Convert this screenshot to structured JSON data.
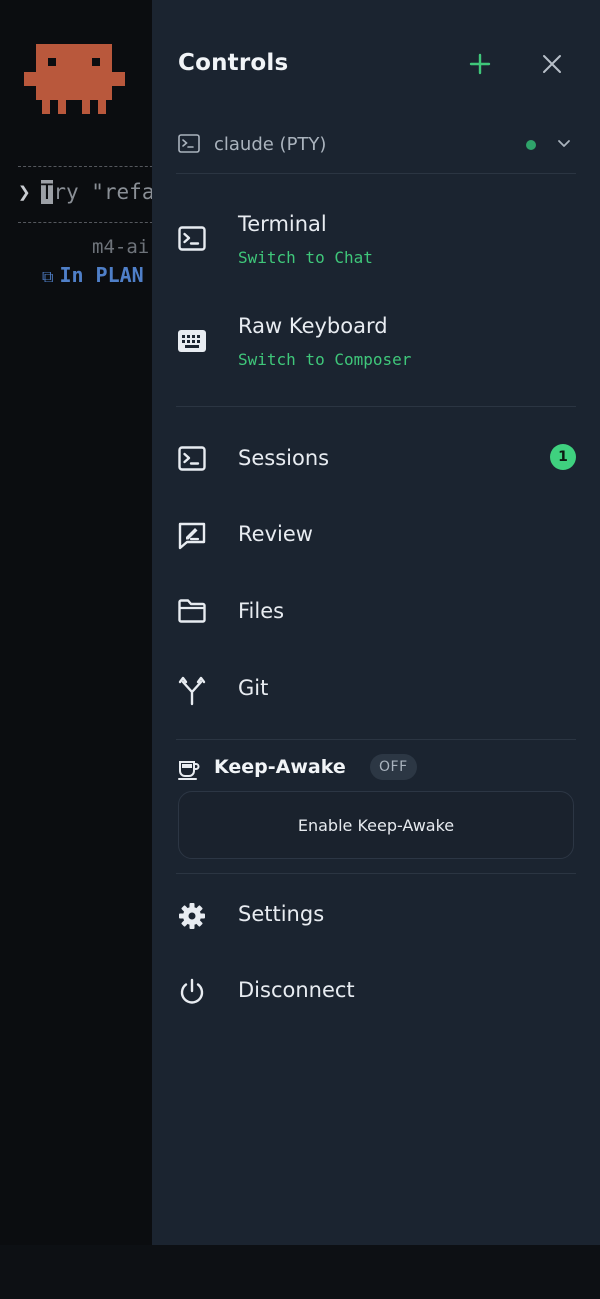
{
  "terminal": {
    "prompt_chevron": "❯",
    "prompt_cursor_char": "T",
    "prompt_text": "ry \"refa",
    "model_text": "m4-ai",
    "mode_icon": "⧉",
    "mode_text": "In PLAN",
    "mascot_color": "#b9583c"
  },
  "drawer": {
    "title": "Controls",
    "accent_color": "#3fc77a",
    "background": "#1b2430",
    "add_icon": "plus-icon",
    "close_icon": "close-icon"
  },
  "session": {
    "name": "claude (PTY)",
    "status": "connected",
    "status_color": "#2fa36a"
  },
  "modes": [
    {
      "title": "Terminal",
      "subtitle": "Switch to Chat",
      "icon": "terminal-icon"
    },
    {
      "title": "Raw Keyboard",
      "subtitle": "Switch to Composer",
      "icon": "keyboard-icon"
    }
  ],
  "nav": {
    "sessions": {
      "label": "Sessions",
      "badge": "1",
      "icon": "terminal-icon"
    },
    "review": {
      "label": "Review",
      "icon": "review-icon"
    },
    "files": {
      "label": "Files",
      "icon": "folder-icon"
    },
    "git": {
      "label": "Git",
      "icon": "git-branch-icon"
    },
    "settings": {
      "label": "Settings",
      "icon": "gear-icon"
    },
    "disconnect": {
      "label": "Disconnect",
      "icon": "power-icon"
    }
  },
  "keep_awake": {
    "title": "Keep-Awake",
    "status": "OFF",
    "button_label": "Enable Keep-Awake",
    "icon": "coffee-cup-icon"
  }
}
